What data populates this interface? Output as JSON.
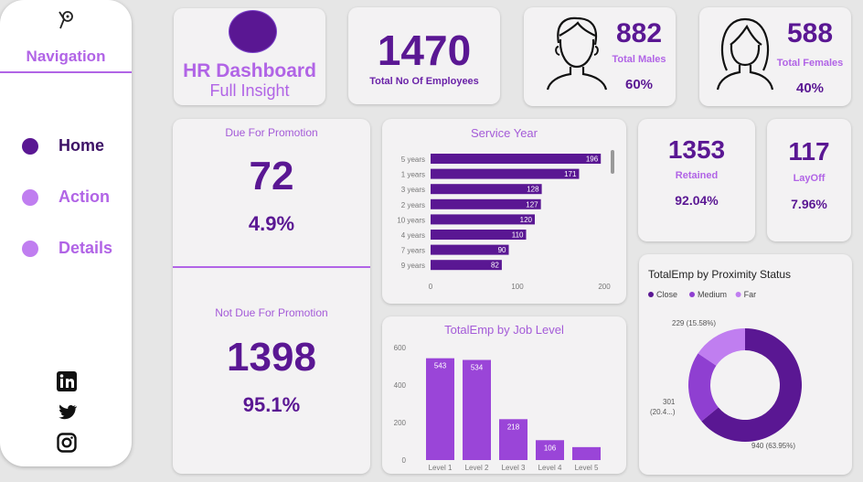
{
  "nav": {
    "title": "Navigation",
    "items": [
      {
        "label": "Home",
        "color": "#5a1793"
      },
      {
        "label": "Action",
        "color": "#c07ef0"
      },
      {
        "label": "Details",
        "color": "#c07ef0"
      }
    ]
  },
  "header": {
    "title": "HR Dashboard",
    "subtitle": "Full Insight"
  },
  "kpi_total": {
    "value": "1470",
    "label": "Total No Of Employees"
  },
  "kpi_males": {
    "value": "882",
    "label": "Total Males",
    "pct": "60%"
  },
  "kpi_females": {
    "value": "588",
    "label": "Total Females",
    "pct": "40%"
  },
  "promotion": {
    "title": "Due For Promotion",
    "value": "72",
    "pct": "4.9%"
  },
  "not_promotion": {
    "title": "Not Due For Promotion",
    "value": "1398",
    "pct": "95.1%"
  },
  "retained": {
    "value": "1353",
    "label": "Retained",
    "pct": "92.04%"
  },
  "layoff": {
    "value": "117",
    "label": "LayOff",
    "pct": "7.96%"
  },
  "colors": {
    "dark": "#5a1793",
    "medium": "#8f3fd1",
    "light": "#c07ef0",
    "bar": "#5a1793",
    "jobbar": "#9a45d8"
  },
  "chart_data": [
    {
      "type": "bar",
      "orientation": "horizontal",
      "title": "Service Year",
      "categories": [
        "5 years",
        "1 years",
        "3 years",
        "2 years",
        "10 years",
        "4 years",
        "7 years",
        "9 years"
      ],
      "values": [
        196,
        171,
        128,
        127,
        120,
        110,
        90,
        82
      ],
      "xticks": [
        "0",
        "100",
        "200"
      ],
      "xlim": [
        0,
        200
      ]
    },
    {
      "type": "bar",
      "title": "TotalEmp by Job Level",
      "categories": [
        "Level 1",
        "Level 2",
        "Level 3",
        "Level 4",
        "Level 5"
      ],
      "values": [
        543,
        534,
        218,
        106,
        69
      ],
      "data_labels": [
        "543",
        "534",
        "218",
        "106",
        ""
      ],
      "yticks": [
        "600",
        "400",
        "200",
        "0"
      ],
      "ylim": [
        0,
        600
      ]
    },
    {
      "type": "pie",
      "title": "TotalEmp by Proximity Status",
      "legend": [
        "Close",
        "Medium",
        "Far"
      ],
      "values": [
        940,
        301,
        229
      ],
      "labels": [
        "940 (63.95%)",
        "301",
        "(20.4...)",
        "229 (15.58%)"
      ]
    }
  ]
}
